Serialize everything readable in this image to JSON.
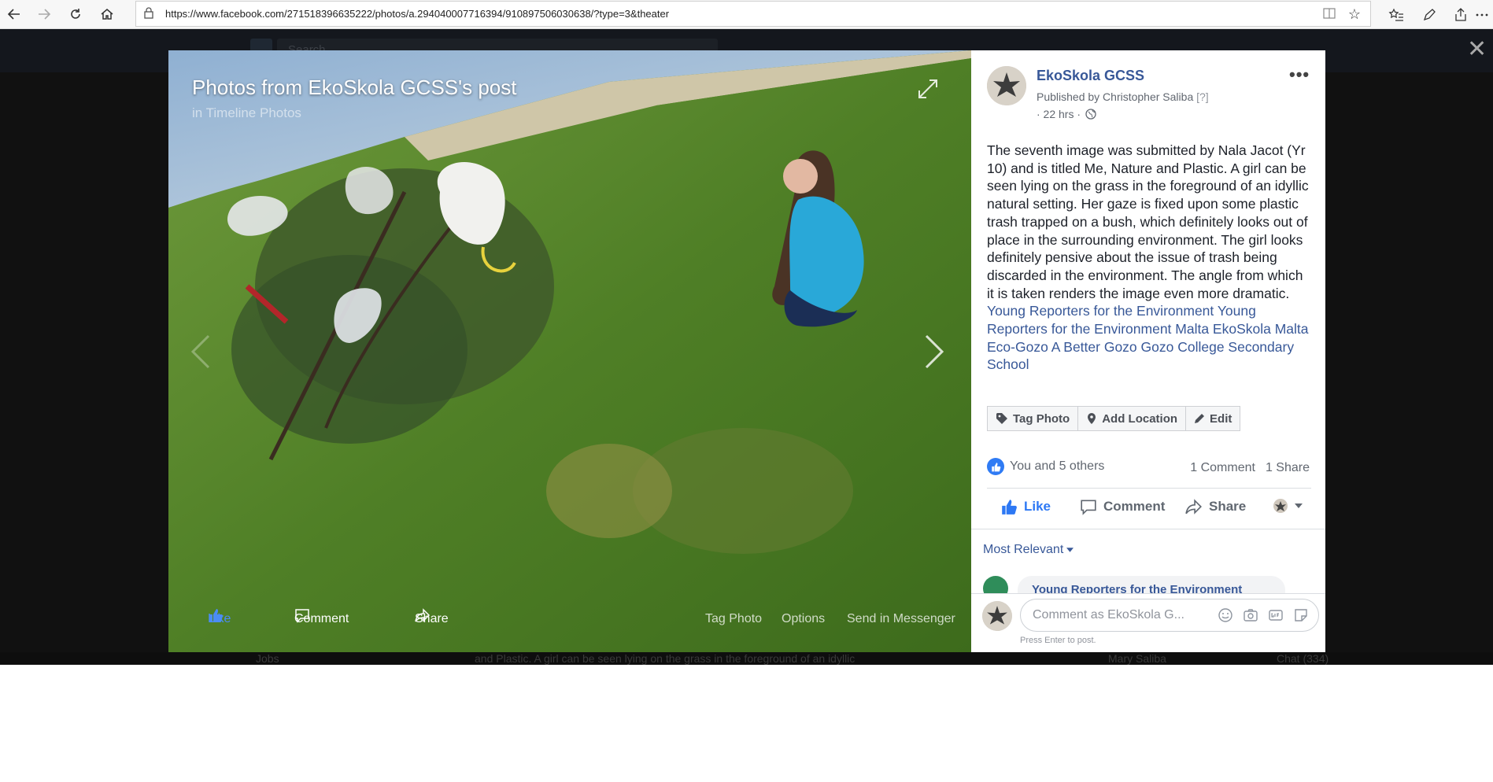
{
  "browser": {
    "url": "https://www.facebook.com/271518396635222/photos/a.294040007716394/910897506030638/?type=3&theater"
  },
  "background": {
    "search_placeholder": "Search",
    "bottom_strip_left": "Jobs",
    "bottom_strip_text": "and Plastic. A girl can be seen lying on the grass in the foreground of an idyllic",
    "bottom_strip_name": "Mary Saliba",
    "chat_label": "Chat (334)"
  },
  "photo": {
    "title": "Photos from EkoSkola GCSS's post",
    "subtitle": "in Timeline Photos",
    "actions": {
      "like": "Like",
      "comment": "Comment",
      "share": "Share",
      "tag_photo": "Tag Photo",
      "options": "Options",
      "send_messenger": "Send in Messenger"
    }
  },
  "post": {
    "page_name": "EkoSkola GCSS",
    "published_by": "Published by Christopher Saliba",
    "help_marker": "[?]",
    "time": "· 22 hrs ·",
    "body": "The seventh image was submitted by Nala Jacot (Yr 10) and is titled Me, Nature and Plastic. A girl can be seen lying on the grass in the foreground of an idyllic natural setting. Her gaze is fixed upon some plastic trash trapped on a bush, which definitely looks out of place in the surrounding environment. The girl looks definitely pensive about the issue of trash being discarded in the environment. The angle from which it is taken renders the image even more dramatic.",
    "tags": "Young Reporters for the Environment Young Reporters for the Environment Malta EkoSkola Malta Eco-Gozo A Better Gozo Gozo College Secondary School",
    "buttons": {
      "tag_photo": "Tag Photo",
      "add_location": "Add Location",
      "edit": "Edit"
    },
    "reactions": "You and 5 others",
    "comment_count": "1 Comment",
    "share_count": "1 Share",
    "actions": {
      "like": "Like",
      "comment": "Comment",
      "share": "Share"
    },
    "sort_label": "Most Relevant",
    "preview_commenter": "Young Reporters for the Environment",
    "composer_placeholder": "Comment as EkoSkola G...",
    "press_enter": "Press Enter to post."
  }
}
